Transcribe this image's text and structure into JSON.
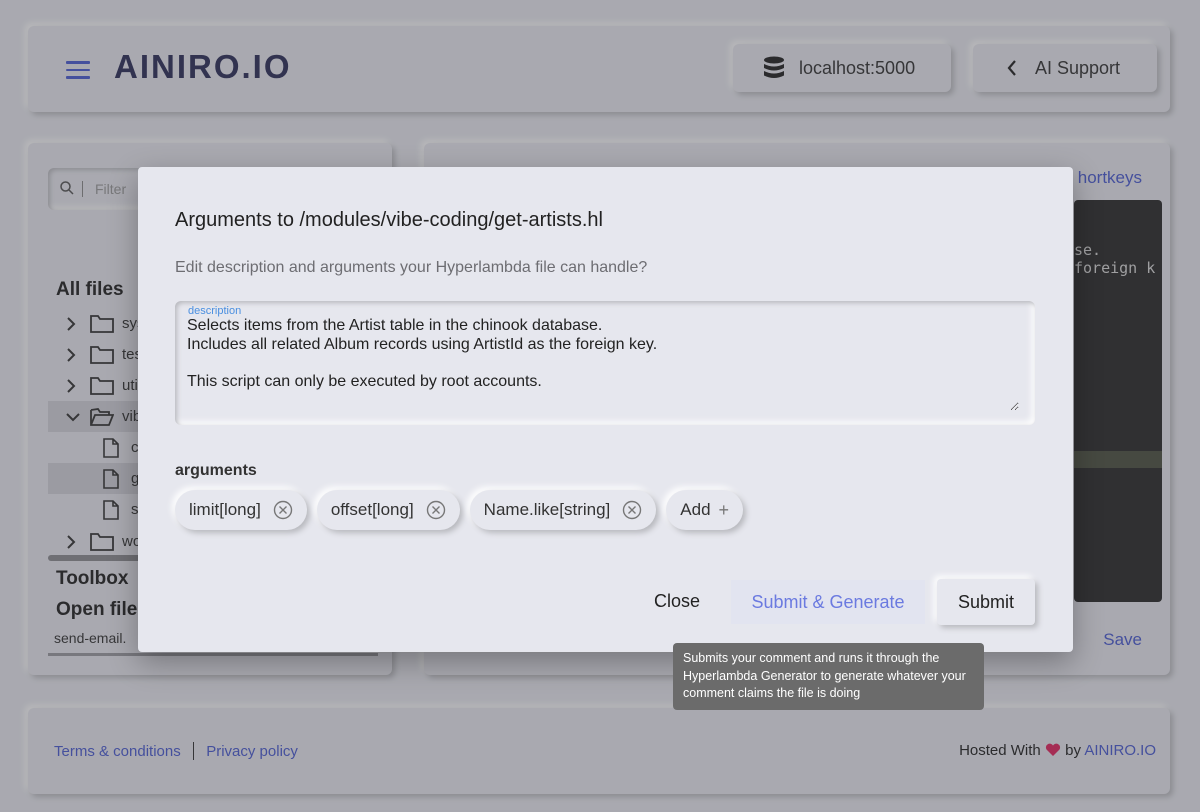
{
  "header": {
    "logo": "AINIRO.IO",
    "server_label": "localhost:5000",
    "support_label": "AI Support"
  },
  "left": {
    "filter_placeholder": "Filter",
    "all_files_title": "All files",
    "tree": [
      {
        "label": "sys",
        "type": "folder",
        "expanded": false
      },
      {
        "label": "tes",
        "type": "folder",
        "expanded": false
      },
      {
        "label": "util",
        "type": "folder",
        "expanded": false
      },
      {
        "label": "vib",
        "type": "folder",
        "expanded": true
      },
      {
        "label": "c",
        "type": "file"
      },
      {
        "label": "g",
        "type": "file",
        "selected": true
      },
      {
        "label": "s",
        "type": "file"
      },
      {
        "label": "wo",
        "type": "folder",
        "expanded": false
      }
    ],
    "toolbox_title": "Toolbox",
    "open_files_title": "Open file",
    "open_file_name": "send-email."
  },
  "right": {
    "shortkeys_link": "hortkeys",
    "editor_lines": [
      "se.",
      "foreign k"
    ],
    "save_link": "Save"
  },
  "footer": {
    "terms": "Terms & conditions",
    "privacy": "Privacy policy",
    "hosted_prefix": "Hosted With",
    "hosted_by": "by",
    "hosted_brand": "AINIRO.IO"
  },
  "modal": {
    "title": "Arguments to /modules/vibe-coding/get-artists.hl",
    "subtitle": "Edit description and arguments your Hyperlambda file can handle?",
    "description_label": "description",
    "description_value": "Selects items from the Artist table in the chinook database.\nIncludes all related Album records using ArtistId as the foreign key.\n\nThis script can only be executed by root accounts.",
    "arguments_title": "arguments",
    "arguments": [
      "limit[long]",
      "offset[long]",
      "Name.like[string]"
    ],
    "add_label": "Add",
    "close_label": "Close",
    "generate_label": "Submit & Generate",
    "submit_label": "Submit"
  },
  "tooltip": {
    "text": "Submits your comment and runs it through the Hyperlambda Generator to generate whatever your comment claims the file is doing"
  },
  "colors": {
    "accent": "#4a5bd0",
    "background": "#e6e7ee",
    "heart": "#e0245e"
  }
}
